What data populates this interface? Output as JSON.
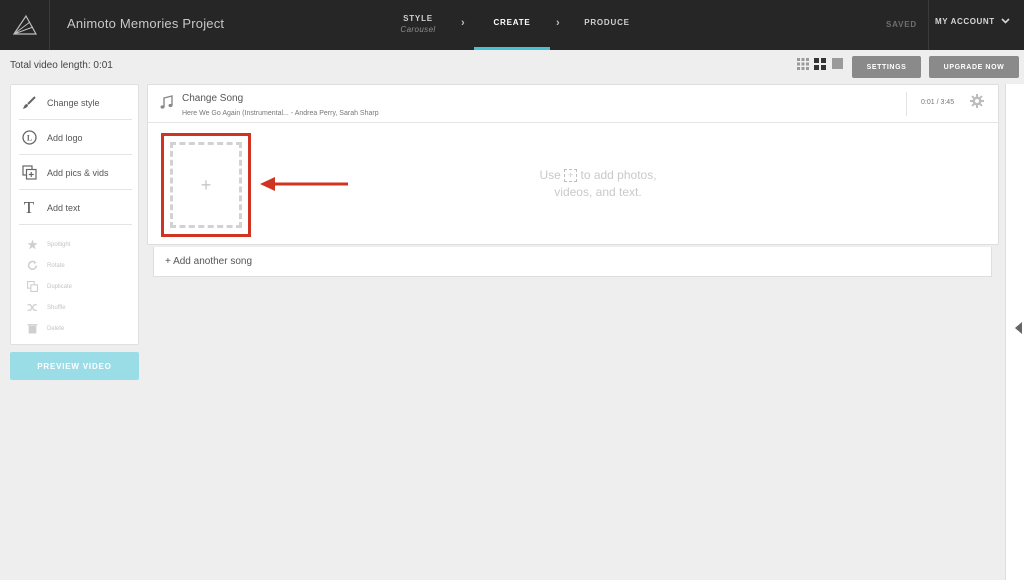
{
  "header": {
    "project_title": "Animoto Memories Project",
    "steps": [
      {
        "label": "STYLE",
        "sub": "Carousel"
      },
      {
        "label": "CREATE"
      },
      {
        "label": "PRODUCE"
      }
    ],
    "saved": "SAVED",
    "account": "MY ACCOUNT"
  },
  "toolbar": {
    "video_length": "Total video length: 0:01",
    "settings_label": "SETTINGS",
    "upgrade_label": "UPGRADE NOW",
    "accent": "#46c2d4"
  },
  "sidebar": {
    "tools": [
      {
        "label": "Change style",
        "icon": "brush-icon"
      },
      {
        "label": "Add logo",
        "icon": "logo-icon"
      },
      {
        "label": "Add pics & vids",
        "icon": "add-media-icon"
      },
      {
        "label": "Add text",
        "icon": "text-icon"
      }
    ],
    "disabled": [
      {
        "label": "Spotlight",
        "icon": "star-icon"
      },
      {
        "label": "Rotate",
        "icon": "rotate-icon"
      },
      {
        "label": "Duplicate",
        "icon": "duplicate-icon"
      },
      {
        "label": "Shuffle",
        "icon": "shuffle-icon"
      },
      {
        "label": "Delete",
        "icon": "trash-icon"
      }
    ],
    "preview_label": "PREVIEW VIDEO"
  },
  "song": {
    "title": "Change Song",
    "artist": "Here We Go Again (Instrumental... - Andrea Perry, Sarah Sharp",
    "time": "0:01 / 3:45",
    "hint_before": "Use",
    "hint_after": "to add photos,",
    "hint_line2": "videos, and text.",
    "add_another": "+ Add another song",
    "highlight_color": "#d13321"
  }
}
